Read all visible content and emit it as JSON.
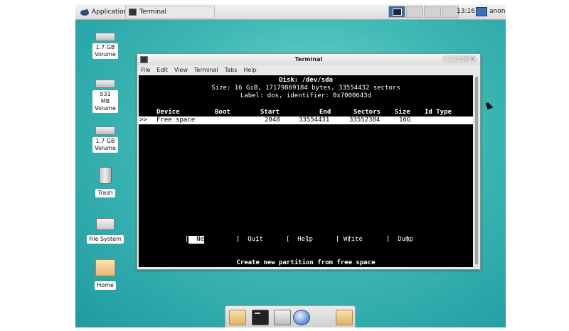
{
  "panel": {
    "applications_label": "Applications",
    "task_label": "Terminal",
    "clock": "13:16",
    "user": "anon"
  },
  "desktop_icons": [
    {
      "label": "1.7 GB Volume",
      "icon": "drive-icon"
    },
    {
      "label": "531 MB Volume",
      "icon": "drive-icon"
    },
    {
      "label": "1.7 GB Volume",
      "icon": "drive-icon"
    },
    {
      "label": "Trash",
      "icon": "trash-icon"
    },
    {
      "label": "File System",
      "icon": "filesystem-icon"
    },
    {
      "label": "Home",
      "icon": "home-folder-icon"
    }
  ],
  "terminal": {
    "title": "Terminal",
    "menu": [
      "File",
      "Edit",
      "View",
      "Terminal",
      "Tabs",
      "Help"
    ],
    "disk_line": "Disk: /dev/sda",
    "size_line": "Size: 16 GiB, 17179869184 bytes, 33554432 sectors",
    "label_line": "Label: dos, identifier: 0x7000643d",
    "columns": [
      "Device",
      "Boot",
      "Start",
      "End",
      "Sectors",
      "Size",
      "Id Type"
    ],
    "row": {
      "marker": ">>",
      "device": "Free space",
      "boot": "",
      "start": "2048",
      "end": "33554431",
      "sectors": "33552384",
      "size": "16G",
      "type": ""
    },
    "actions": [
      "New",
      "Quit",
      "Help",
      "Write",
      "Dump"
    ],
    "selected_action": "New",
    "status": "Create new partition from free space"
  },
  "colors": {
    "desktop_teal": "#3fb9b5",
    "console_bg": "#000000",
    "console_fg": "#ffffff"
  }
}
